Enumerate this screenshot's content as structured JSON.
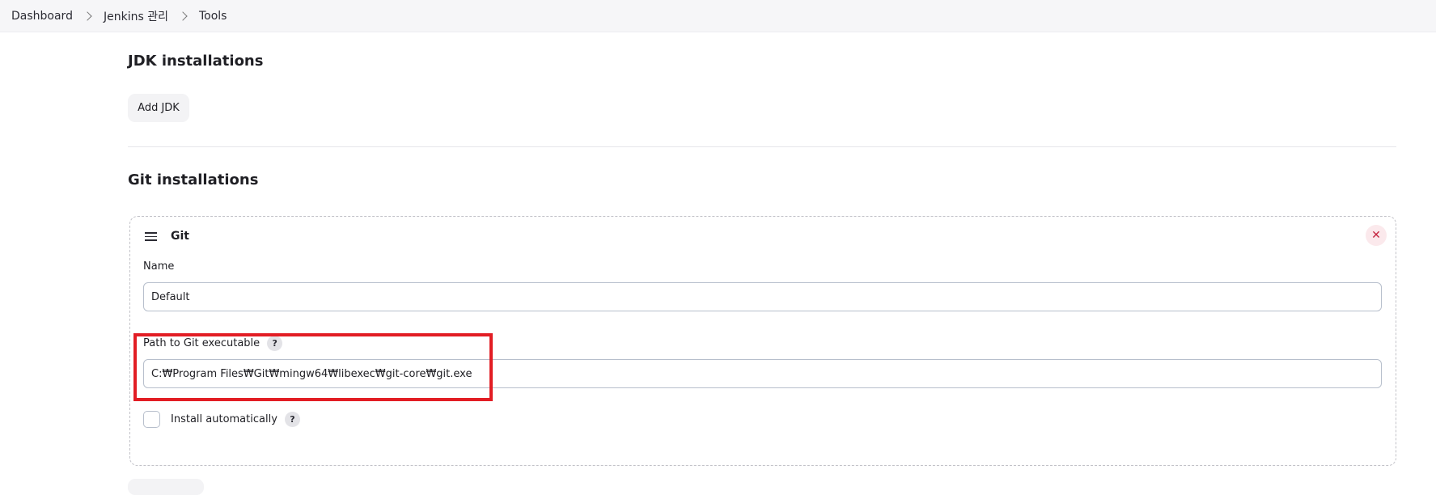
{
  "breadcrumb": {
    "items": [
      "Dashboard",
      "Jenkins 관리",
      "Tools"
    ]
  },
  "jdk": {
    "title": "JDK installations",
    "add_button": "Add JDK"
  },
  "git": {
    "title": "Git installations",
    "card": {
      "title": "Git",
      "delete_symbol": "✕",
      "name_label": "Name",
      "name_value": "Default",
      "path_label": "Path to Git executable",
      "path_value": "C:₩Program Files₩Git₩mingw64₩libexec₩git-core₩git.exe",
      "install_label": "Install automatically",
      "install_checked": false,
      "help_symbol": "?"
    }
  },
  "colors": {
    "highlight": "#e21d24",
    "danger": "#c4243f"
  },
  "icons": [
    "chevron-right-icon",
    "hamburger-icon",
    "close-icon",
    "help-icon"
  ]
}
